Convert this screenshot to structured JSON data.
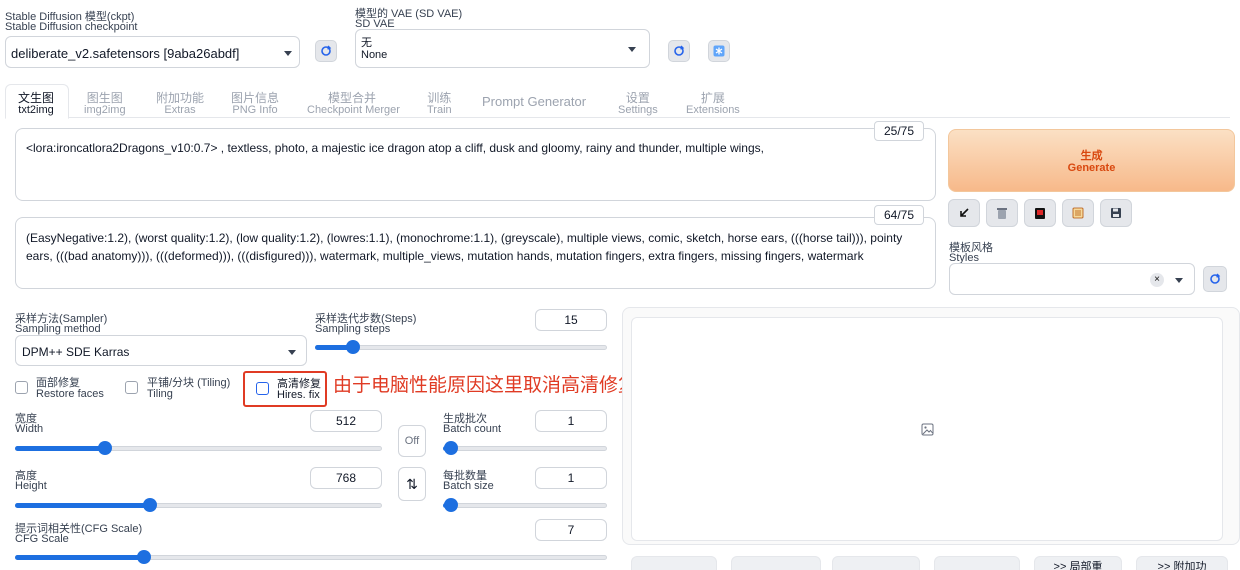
{
  "checkpoint": {
    "label_cn": "Stable Diffusion 模型(ckpt)",
    "label_en": "Stable Diffusion checkpoint",
    "value": "deliberate_v2.safetensors [9aba26abdf]"
  },
  "vae": {
    "label_cn": "模型的 VAE (SD VAE)",
    "label_en": "SD VAE",
    "value_cn": "无",
    "value_en": "None"
  },
  "tabs": [
    {
      "cn": "文生图",
      "en": "txt2img"
    },
    {
      "cn": "图生图",
      "en": "img2img"
    },
    {
      "cn": "附加功能",
      "en": "Extras"
    },
    {
      "cn": "图片信息",
      "en": "PNG Info"
    },
    {
      "cn": "模型合并",
      "en": "Checkpoint Merger"
    },
    {
      "cn": "训练",
      "en": "Train"
    },
    {
      "cn": "Prompt Generator",
      "en": ""
    },
    {
      "cn": "设置",
      "en": "Settings"
    },
    {
      "cn": "扩展",
      "en": "Extensions"
    }
  ],
  "prompt": {
    "text": "<lora:ironcatlora2Dragons_v10:0.7> , textless, photo, a majestic ice dragon atop a cliff, dusk and gloomy, rainy and thunder, multiple wings,",
    "counter": "25/75"
  },
  "negative_prompt": {
    "text": "(EasyNegative:1.2), (worst quality:1.2), (low quality:1.2), (lowres:1.1), (monochrome:1.1), (greyscale), multiple views, comic, sketch, horse ears, (((horse tail))), pointy ears, (((bad anatomy))), (((deformed))), (((disfigured))), watermark, multiple_views, mutation hands, mutation fingers, extra fingers, missing fingers, watermark",
    "counter": "64/75"
  },
  "generate": {
    "cn": "生成",
    "en": "Generate"
  },
  "styles": {
    "cn": "模板风格",
    "en": "Styles"
  },
  "sampler": {
    "label_cn": "采样方法(Sampler)",
    "label_en": "Sampling method",
    "value": "DPM++ SDE Karras"
  },
  "steps": {
    "label_cn": "采样迭代步数(Steps)",
    "label_en": "Sampling steps",
    "value": "15",
    "fraction": 0.11
  },
  "restore_faces": {
    "cn": "面部修复",
    "en": "Restore faces"
  },
  "tiling": {
    "cn": "平铺/分块 (Tiling)",
    "en": "Tiling"
  },
  "hires": {
    "cn": "高清修复",
    "en": "Hires. fix"
  },
  "annotation": "由于电脑性能原因这里取消高清修复选项",
  "width": {
    "cn": "宽度",
    "en": "Width",
    "value": "512",
    "fraction": 0.235
  },
  "height": {
    "cn": "高度",
    "en": "Height",
    "value": "768",
    "fraction": 0.363
  },
  "off_label": "Off",
  "swap_label": "⇅",
  "batch_count": {
    "cn": "生成批次",
    "en": "Batch count",
    "value": "1",
    "fraction": 0.0
  },
  "batch_size": {
    "cn": "每批数量",
    "en": "Batch size",
    "value": "1",
    "fraction": 0.0
  },
  "cfg": {
    "cn": "提示词相关性(CFG Scale)",
    "en": "CFG Scale",
    "value": "7",
    "fraction": 0.21
  },
  "bottom_buttons": [
    ">> 局部重",
    ">> 附加功"
  ],
  "colors": {
    "accent": "#1d6fe0",
    "generate_start": "#fbe0c4",
    "generate_end": "#f7b98a",
    "generate_text": "#d9480f",
    "annotation": "#e03b24"
  }
}
